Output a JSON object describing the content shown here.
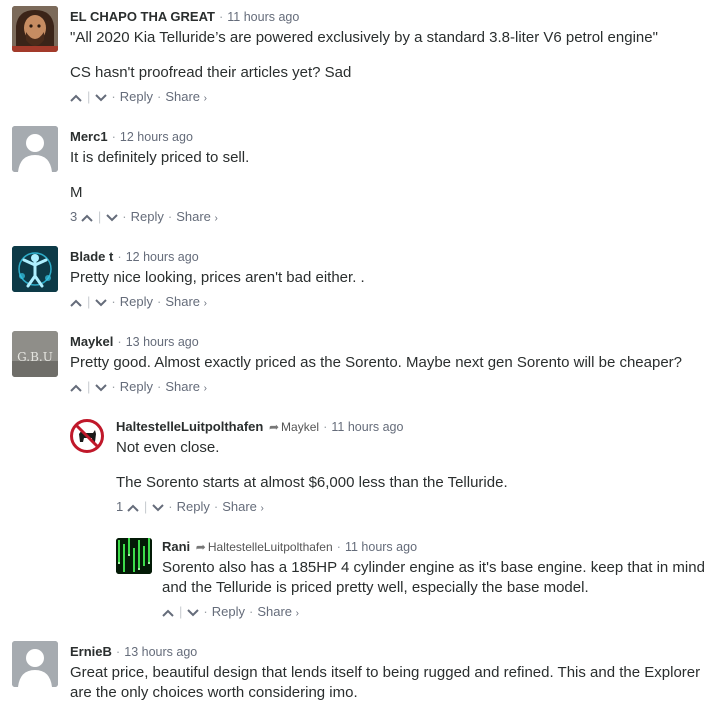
{
  "comments": [
    {
      "author": "EL CHAPO THA GREAT",
      "time": "11 hours ago",
      "paragraphs": [
        "\"All 2020 Kia Telluride’s are powered exclusively by a standard 3.8-liter V6 petrol engine\"",
        "CS hasn't proofread their articles yet? Sad"
      ],
      "upvotes": "",
      "avatar": "photo-face"
    },
    {
      "author": "Merc1",
      "time": "12 hours ago",
      "paragraphs": [
        "It is definitely priced to sell.",
        "M"
      ],
      "upvotes": "3",
      "avatar": "default-user"
    },
    {
      "author": "Blade t",
      "time": "12 hours ago",
      "paragraphs": [
        "Pretty nice looking, prices aren't bad either. ."
      ],
      "upvotes": "",
      "avatar": "blue-figure"
    },
    {
      "author": "Maykel",
      "time": "13 hours ago",
      "paragraphs": [
        "Pretty good. Almost exactly priced as the Sorento. Maybe next gen Sorento will be cheaper?"
      ],
      "upvotes": "",
      "avatar": "gbu-text",
      "avatar_text": "G.B.U"
    },
    {
      "author": "HaltestelleLuitpolthafen",
      "reply_to": "Maykel",
      "time": "11 hours ago",
      "paragraphs": [
        "Not even close.",
        "The Sorento starts at almost $6,000 less than the Telluride."
      ],
      "upvotes": "1",
      "avatar": "no-dog-sign"
    },
    {
      "author": "Rani",
      "reply_to": "HaltestelleLuitpolthafen",
      "time": "11 hours ago",
      "paragraphs": [
        "Sorento also has a 185HP 4 cylinder engine as it's base engine. keep that in mind and the Telluride is priced pretty well, especially the base model."
      ],
      "upvotes": "",
      "avatar": "matrix-code"
    },
    {
      "author": "ErnieB",
      "time": "13 hours ago",
      "paragraphs": [
        "Great price, beautiful design that lends itself to being rugged and refined. This and the Explorer are the only choices worth considering imo."
      ],
      "upvotes": "",
      "avatar": "default-user"
    }
  ],
  "labels": {
    "reply": "Reply",
    "share": "Share",
    "share_arrow": "›",
    "reply_arrow": "➦"
  },
  "colors": {
    "text": "#2a2e2e",
    "muted": "#656c7a",
    "separator": "#c9cdd1"
  }
}
